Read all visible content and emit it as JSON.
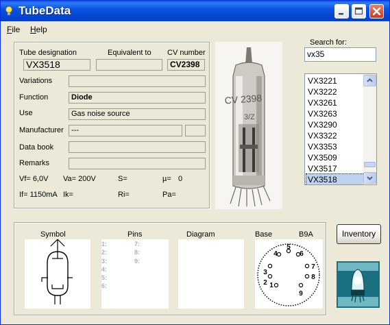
{
  "window": {
    "title": "TubeData"
  },
  "menu": {
    "file": "ile",
    "file_accel": "F",
    "help": "elp",
    "help_accel": "H"
  },
  "tube": {
    "designation_label": "Tube designation",
    "designation_value": "VX3518",
    "equivalent_label": "Equivalent to",
    "equivalent_value": "",
    "cv_label": "CV number",
    "cv_value": "CV2398",
    "variations_label": "Variations",
    "variations_value": "",
    "function_label": "Function",
    "function_value": "Diode",
    "use_label": "Use",
    "use_value": "Gas noise source",
    "manufacturer_label": "Manufacturer",
    "manufacturer_value": "---",
    "databook_label": "Data book",
    "databook_value": "",
    "remarks_label": "Remarks",
    "remarks_value": ""
  },
  "params": {
    "vf": "Vf= 6,0V",
    "va": "Va= 200V",
    "s": "S=",
    "mu": "µ=",
    "mu_value": "0",
    "if": "If= 1150mA",
    "ik": "Ik=",
    "ri": "Ri=",
    "pa": "Pa="
  },
  "search": {
    "label": "Search for:",
    "value": "vx35",
    "results": [
      "VX3221",
      "VX3222",
      "VX3261",
      "VX3263",
      "VX3290",
      "VX3322",
      "VX3353",
      "VX3509",
      "VX3517",
      "VX3518"
    ],
    "selected": "VX3518"
  },
  "bottom": {
    "symbol_label": "Symbol",
    "pins_label": "Pins",
    "diagram_label": "Diagram",
    "base_label": "Base",
    "base_value": "B9A",
    "pins_left": [
      "1:",
      "2:",
      "3:",
      "4:",
      "5:",
      "6:"
    ],
    "pins_right": [
      "7:",
      "8:",
      "9:"
    ],
    "base_pin_numbers": [
      "1",
      "2",
      "3",
      "4",
      "5",
      "6",
      "7",
      "8",
      "9"
    ],
    "inventory_button": "Inventory"
  },
  "photo": {
    "glass_text": "CV 2398",
    "glass_text_2": "3/Z"
  }
}
